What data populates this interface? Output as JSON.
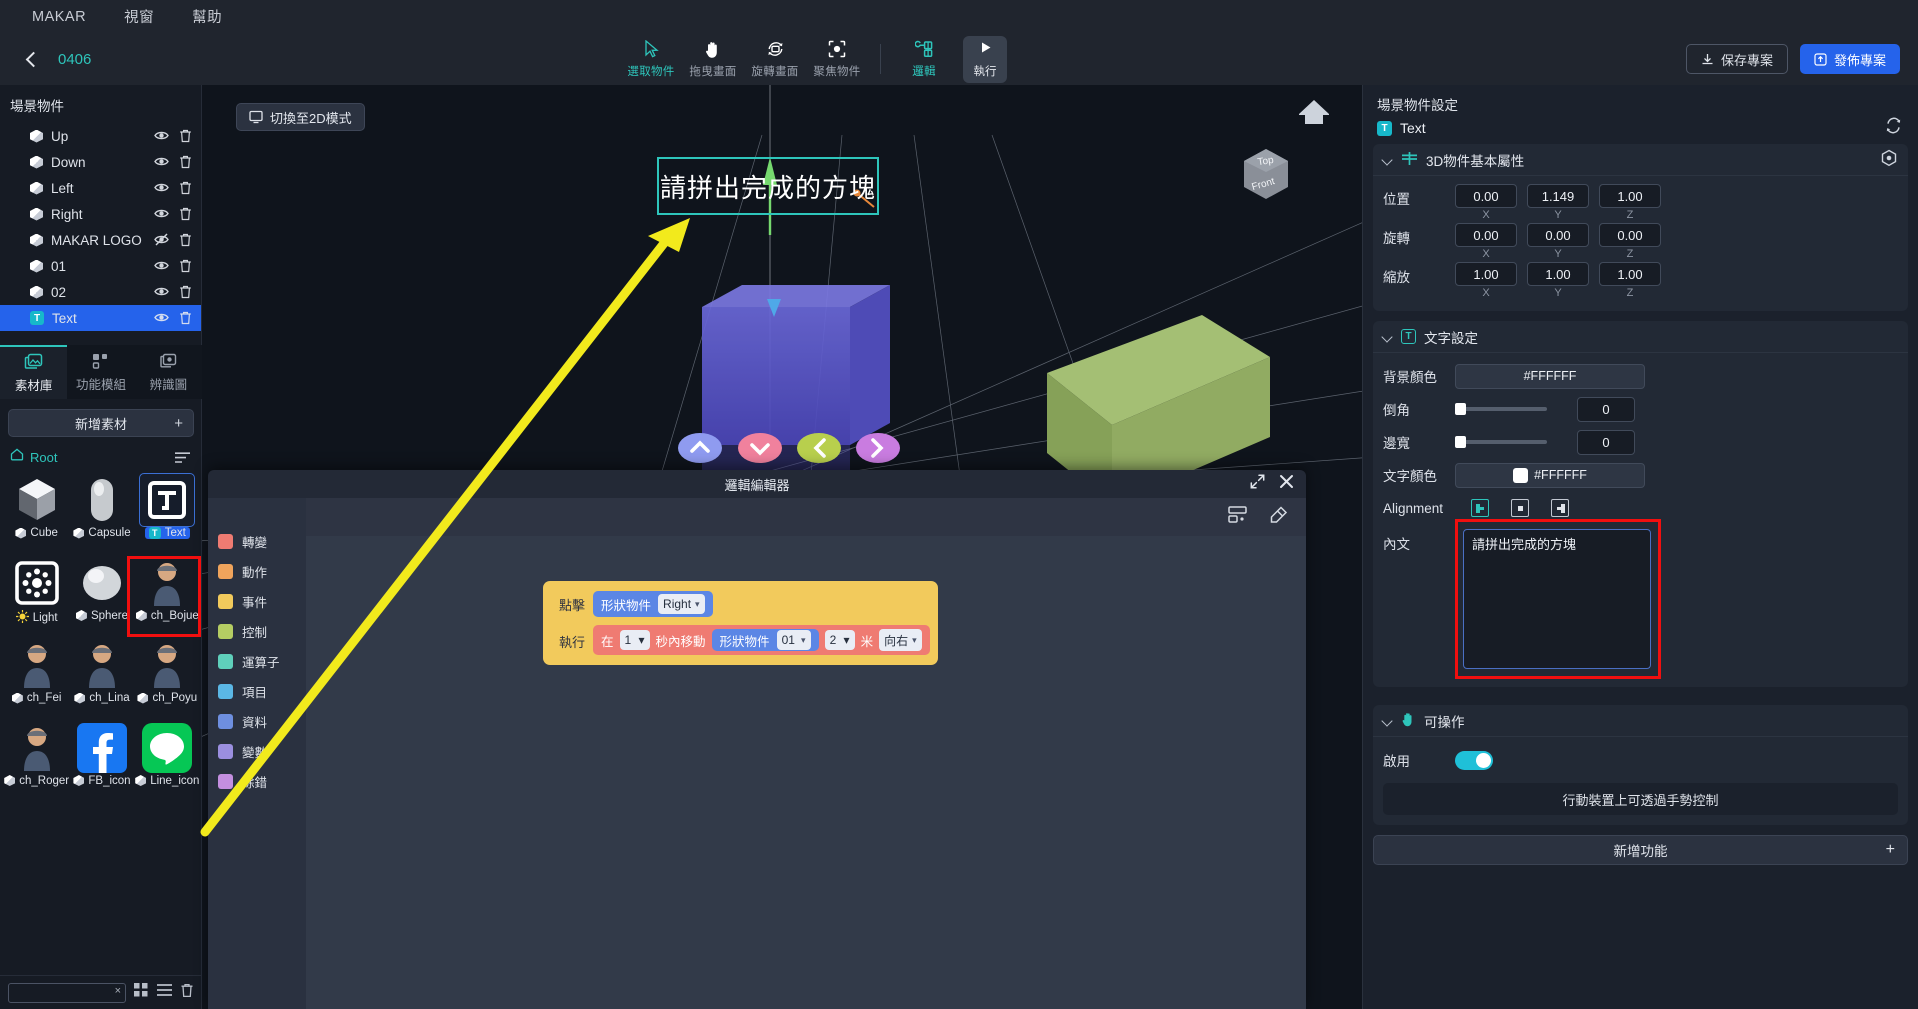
{
  "menubar": {
    "items": [
      "MAKAR",
      "視窗",
      "幫助"
    ]
  },
  "topbar": {
    "project_name": "0406",
    "tools": [
      {
        "label": "選取物件",
        "icon": "cursor-icon",
        "active": true
      },
      {
        "label": "拖曳畫面",
        "icon": "hand-icon",
        "active": false
      },
      {
        "label": "旋轉畫面",
        "icon": "rotate-icon",
        "active": false
      },
      {
        "label": "聚焦物件",
        "icon": "focus-icon",
        "active": false
      },
      {
        "label": "邏輯",
        "icon": "logic-icon",
        "active": true
      }
    ],
    "run_label": "執行",
    "save_label": "保存專案",
    "publish_label": "發佈專案"
  },
  "left_panel": {
    "scene_title": "場景物件",
    "objects": [
      {
        "name": "Up",
        "type": "cube",
        "visible": true
      },
      {
        "name": "Down",
        "type": "cube",
        "visible": true
      },
      {
        "name": "Left",
        "type": "cube",
        "visible": true
      },
      {
        "name": "Right",
        "type": "cube",
        "visible": true
      },
      {
        "name": "MAKAR LOGO",
        "type": "cube",
        "visible": false
      },
      {
        "name": "01",
        "type": "cube",
        "visible": true
      },
      {
        "name": "02",
        "type": "cube",
        "visible": true
      },
      {
        "name": "Text",
        "type": "text",
        "visible": true,
        "selected": true
      }
    ],
    "tabs": [
      {
        "label": "素材庫",
        "icon": "library-icon",
        "active": true
      },
      {
        "label": "功能模組",
        "icon": "module-icon",
        "active": false
      },
      {
        "label": "辨識圖",
        "icon": "marker-icon",
        "active": false
      }
    ],
    "add_asset_label": "新增素材",
    "root_label": "Root",
    "assets": [
      {
        "name": "Cube",
        "icon": "cube-thumb",
        "type": "cube"
      },
      {
        "name": "Capsule",
        "icon": "capsule-thumb",
        "type": "cube"
      },
      {
        "name": "Text",
        "icon": "text-thumb",
        "type": "text",
        "selected": true
      },
      {
        "name": "Light",
        "icon": "light-thumb",
        "type": "light"
      },
      {
        "name": "Sphere",
        "icon": "sphere-thumb",
        "type": "cube"
      },
      {
        "name": "ch_Bojue",
        "icon": "character-thumb",
        "type": "cube"
      },
      {
        "name": "ch_Fei",
        "icon": "character-thumb",
        "type": "cube"
      },
      {
        "name": "ch_Lina",
        "icon": "character-thumb",
        "type": "cube"
      },
      {
        "name": "ch_Poyu",
        "icon": "character-thumb",
        "type": "cube"
      },
      {
        "name": "ch_Roger",
        "icon": "character-thumb",
        "type": "cube"
      },
      {
        "name": "FB_icon",
        "icon": "facebook-thumb",
        "type": "cube"
      },
      {
        "name": "Line_icon",
        "icon": "line-thumb",
        "type": "cube"
      }
    ],
    "search_placeholder": ""
  },
  "viewport": {
    "mode_button": "切換至2D模式",
    "text_object_content": "請拼出完成的方塊",
    "gizmo_top": "Top",
    "gizmo_front": "Front"
  },
  "logic_editor": {
    "title": "邏輯編輯器",
    "categories": [
      {
        "label": "轉變",
        "color": "#ef7b72"
      },
      {
        "label": "動作",
        "color": "#f0a45c"
      },
      {
        "label": "事件",
        "color": "#f2ca5c"
      },
      {
        "label": "控制",
        "color": "#b5cd63"
      },
      {
        "label": "運算子",
        "color": "#5fd0bb"
      },
      {
        "label": "項目",
        "color": "#5bb7e5"
      },
      {
        "label": "資料",
        "color": "#6e8fe0"
      },
      {
        "label": "變數",
        "color": "#9b8fe0"
      },
      {
        "label": "除錯",
        "color": "#c48fe0"
      }
    ],
    "blocks": {
      "event_label": "點擊",
      "event_target_label": "形狀物件",
      "event_target_value": "Right",
      "exec_label": "執行",
      "action_prefix": "在",
      "action_seconds": "1",
      "action_mid": "秒內移動",
      "action_object_label": "形狀物件",
      "action_object_value": "01",
      "action_distance": "2",
      "action_unit": "米",
      "action_direction": "向右"
    }
  },
  "right_panel": {
    "title": "場景物件設定",
    "object_name": "Text",
    "basic_section": {
      "title": "3D物件基本屬性",
      "rows": [
        {
          "label": "位置",
          "x": "0.00",
          "y": "1.149",
          "z": "1.00"
        },
        {
          "label": "旋轉",
          "x": "0.00",
          "y": "0.00",
          "z": "0.00"
        },
        {
          "label": "縮放",
          "x": "1.00",
          "y": "1.00",
          "z": "1.00"
        }
      ],
      "axis_labels": [
        "X",
        "Y",
        "Z"
      ]
    },
    "text_section": {
      "title": "文字設定",
      "bg_color_label": "背景顏色",
      "bg_color_value": "#FFFFFF",
      "bevel_label": "倒角",
      "bevel_value": "0",
      "border_label": "邊寬",
      "border_value": "0",
      "text_color_label": "文字顏色",
      "text_color_value": "#FFFFFF",
      "alignment_label": "Alignment",
      "alignment_selected": 0,
      "content_label": "內文",
      "content_value": "請拼出完成的方塊"
    },
    "operable_section": {
      "title": "可操作",
      "enable_label": "啟用",
      "enabled": true,
      "hint": "行動裝置上可透過手勢控制"
    },
    "add_function_label": "新增功能"
  },
  "colors": {
    "accent_teal": "#2ec5bb",
    "select_blue": "#2563eb",
    "highlight_red": "#f10f0f",
    "arrow_yellow": "#f2ea1c"
  }
}
